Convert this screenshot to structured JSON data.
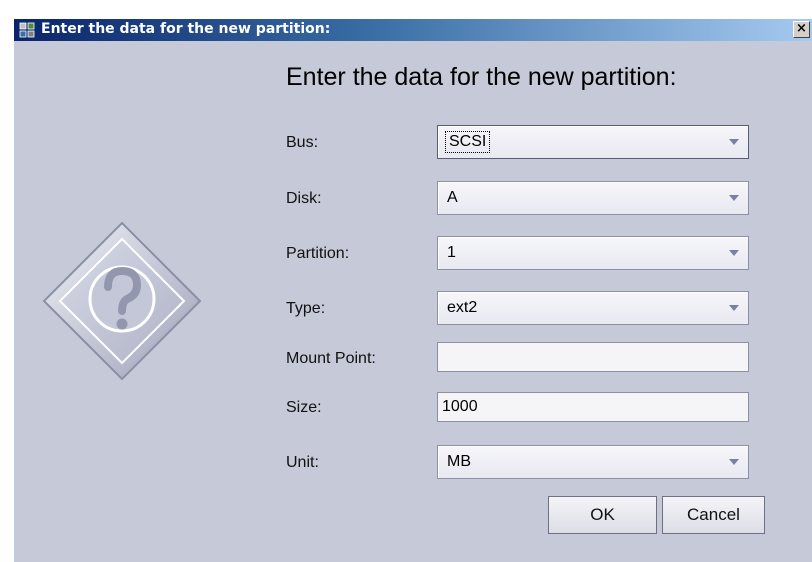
{
  "window": {
    "title": "Enter the data for the new partition:",
    "close_label": "×"
  },
  "dialog": {
    "heading": "Enter the data for the new partition:",
    "fields": {
      "bus": {
        "label": "Bus:",
        "value": "SCSI"
      },
      "disk": {
        "label": "Disk:",
        "value": "A"
      },
      "partition": {
        "label": "Partition:",
        "value": "1"
      },
      "type": {
        "label": "Type:",
        "value": "ext2"
      },
      "mount_point": {
        "label": "Mount Point:",
        "value": ""
      },
      "size": {
        "label": "Size:",
        "value": "1000"
      },
      "unit": {
        "label": "Unit:",
        "value": "MB"
      }
    },
    "buttons": {
      "ok": "OK",
      "cancel": "Cancel"
    }
  },
  "icons": {
    "app": "partition-app-icon",
    "dialog": "question-diamond-icon"
  },
  "colors": {
    "title_bar_start": "#0a246a",
    "title_bar_end": "#a6caf0",
    "dialog_background": "#c6c9d7",
    "combo_arrow": "#7a7fa6"
  }
}
